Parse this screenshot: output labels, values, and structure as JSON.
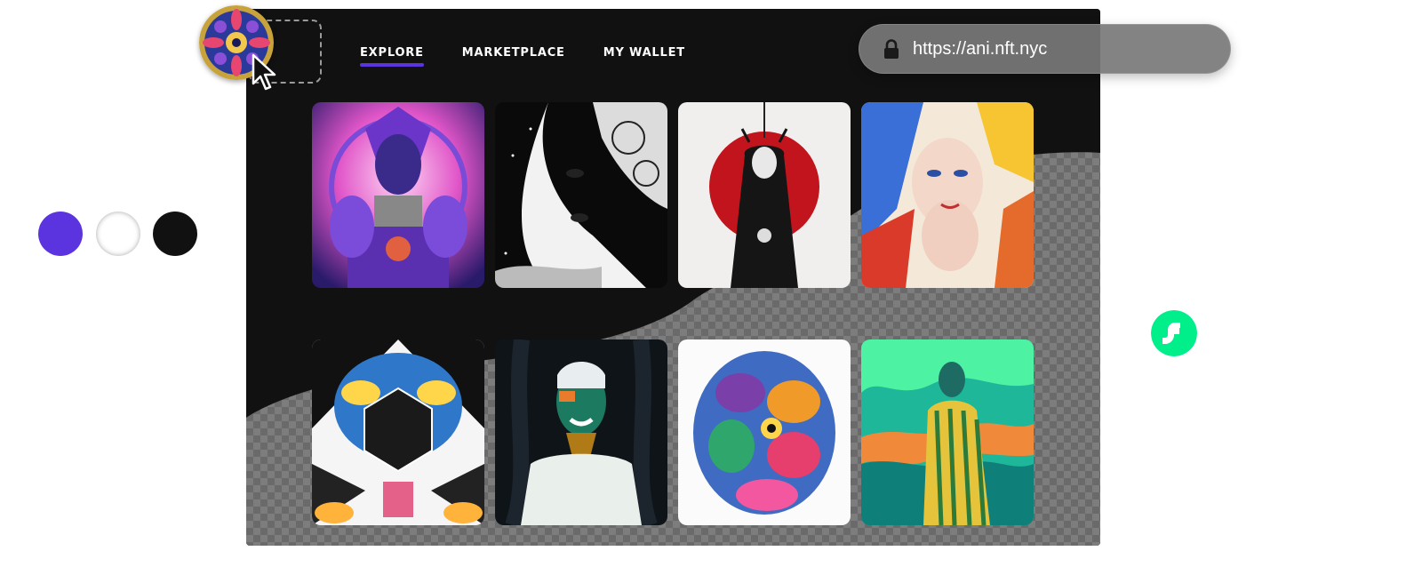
{
  "palette": {
    "accent": "#5b34e0",
    "light": "#ffffff",
    "dark": "#111111",
    "flow_green": "#00ef8b"
  },
  "swatches": [
    {
      "color": "#5b34e0"
    },
    {
      "color": "#ffffff"
    },
    {
      "color": "#111111"
    }
  ],
  "nav": {
    "items": [
      {
        "label": "EXPLORE",
        "active": true
      },
      {
        "label": "MARKETPLACE",
        "active": false
      },
      {
        "label": "MY WALLET",
        "active": false
      }
    ]
  },
  "browser": {
    "url": "https://ani.nft.nyc",
    "icon": "lock-icon"
  },
  "avatar": {
    "icon": "mandala-avatar"
  },
  "logo": {
    "icon": "flow-logo-icon"
  },
  "gallery": {
    "rows": [
      [
        {
          "name": "cosmic-purple-goddess"
        },
        {
          "name": "line-art-face-flowers"
        },
        {
          "name": "red-sun-figure"
        },
        {
          "name": "colorful-faces-collage"
        }
      ],
      [
        {
          "name": "geometric-eyes-pattern"
        },
        {
          "name": "painted-face-portrait"
        },
        {
          "name": "pop-art-faces"
        },
        {
          "name": "green-striped-figure"
        }
      ]
    ]
  }
}
